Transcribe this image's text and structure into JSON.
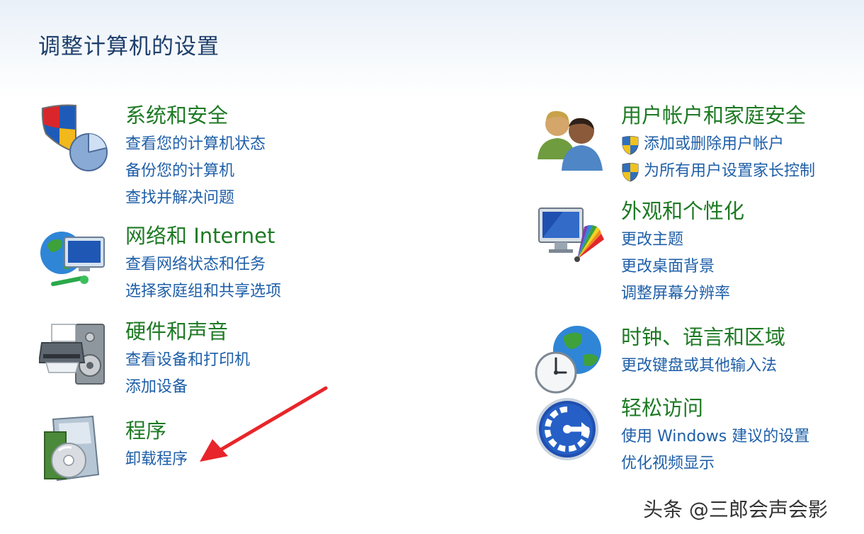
{
  "page_title": "调整计算机的设置",
  "categories": [
    {
      "title": "系统和安全",
      "links": [
        "查看您的计算机状态",
        "备份您的计算机",
        "查找并解决问题"
      ],
      "icon": "shield-icon"
    },
    {
      "title": "网络和 Internet",
      "links": [
        "查看网络状态和任务",
        "选择家庭组和共享选项"
      ],
      "icon": "network-globe-icon"
    },
    {
      "title": "硬件和声音",
      "links": [
        "查看设备和打印机",
        "添加设备"
      ],
      "icon": "printer-icon"
    },
    {
      "title": "程序",
      "links": [
        "卸载程序"
      ],
      "icon": "programs-disc-icon"
    },
    {
      "title": "用户帐户和家庭安全",
      "links": [
        "添加或删除用户帐户",
        "为所有用户设置家长控制"
      ],
      "icon": "users-icon"
    },
    {
      "title": "外观和个性化",
      "links": [
        "更改主题",
        "更改桌面背景",
        "调整屏幕分辨率"
      ],
      "icon": "monitor-palette-icon"
    },
    {
      "title": "时钟、语言和区域",
      "links": [
        "更改键盘或其他输入法"
      ],
      "icon": "clock-globe-icon"
    },
    {
      "title": "轻松访问",
      "links": [
        "使用 Windows 建议的设置",
        "优化视频显示"
      ],
      "icon": "accessibility-icon"
    }
  ],
  "watermark": "头条 @三郎会声会影",
  "colors": {
    "title": "#1e7a24",
    "link": "#1f5fa8",
    "heading": "#1e3f6b",
    "arrow": "#e8252a"
  }
}
